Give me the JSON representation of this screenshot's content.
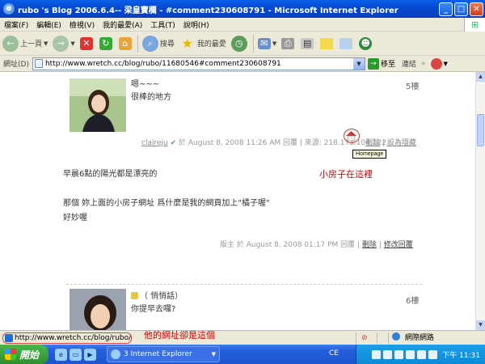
{
  "window": {
    "title": "rubo 's Blog 2006.6.4-- 梁皇寶欄 - #comment230608791 - Microsoft Internet Explorer",
    "minimize_label": "_",
    "maximize_label": "□",
    "close_label": "✕"
  },
  "menu": [
    "檔案(F)",
    "編輯(E)",
    "檢視(V)",
    "我的最愛(A)",
    "工具(T)",
    "說明(H)"
  ],
  "toolbar": {
    "back_label": "上一頁",
    "search_label": "搜尋",
    "favorites_label": "我的最愛"
  },
  "address": {
    "label": "網址(D)",
    "url": "http://www.wretch.cc/blog/rubo/11680546#comment230608791",
    "go_label": "移至",
    "links_label": "連結"
  },
  "comments": [
    {
      "lines": [
        "嗯~~~",
        "很棒的地方"
      ],
      "floor": "5樓",
      "author": "claireju",
      "meta": "於 August 8, 2008 11:26 AM 回覆 | 來源: 218.173.104.122",
      "actions": [
        "刪除",
        "設為隱藏"
      ],
      "tooltip": "Homepage"
    },
    {
      "lines": [
        "（ 悄悄話）",
        "你提早去囉?"
      ],
      "floor": "6樓"
    }
  ],
  "reply": {
    "lines": [
      "早晨6點的陽光都是漂亮的",
      "",
      "那個 妳上面的小房子網址 爲什麼是我的網頁加上\"橘子喔\"",
      "好妙喔"
    ],
    "meta": "版主 於 August 8, 2008 01:17 PM 回覆 |",
    "actions": [
      "刪除",
      "修改回覆"
    ]
  },
  "annotations": {
    "house": "小房子在這裡",
    "url": "他的網址卻是這個"
  },
  "status": {
    "url": "http://www.wretch.cc/blog/rubo/橘子喔",
    "zone": "網際網路"
  },
  "taskbar": {
    "start_label": "開始",
    "task_label": "3 Internet Explorer",
    "ime_label": "CE",
    "clock": "下午 11:31"
  }
}
